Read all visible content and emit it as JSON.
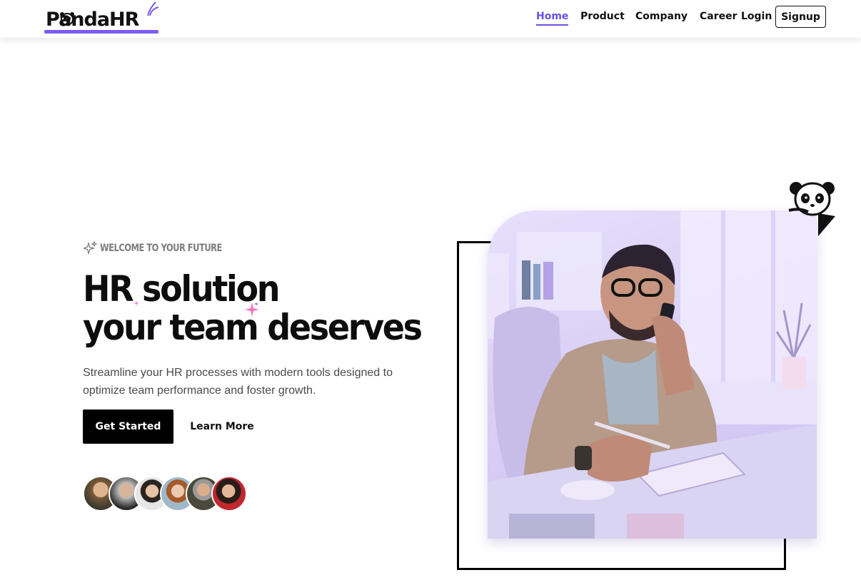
{
  "brand": {
    "logo_text_main": "PandaHR",
    "accent_color": "#6b4ee6",
    "logo_underline_color": "#7a5df0"
  },
  "nav": {
    "items": [
      {
        "label": "Home",
        "active": true
      },
      {
        "label": "Product",
        "active": false
      },
      {
        "label": "Company",
        "active": false
      },
      {
        "label": "Career",
        "active": false
      },
      {
        "label": "Login",
        "active": false
      }
    ],
    "signup_label": "Signup"
  },
  "hero": {
    "eyebrow": "WELCOME TO YOUR FUTURE",
    "headline_line1": "HR solution",
    "headline_line2": "your team deserves",
    "subtitle": "Streamline your HR processes with modern tools designed to optimize team performance and foster growth.",
    "primary_cta": "Get Started",
    "secondary_cta": "Learn More",
    "avatar_count": 6
  },
  "colors": {
    "primary_button_bg": "#000000",
    "photo_tint": "#d9cff6",
    "sparkle_pink": "#f07ac0"
  }
}
